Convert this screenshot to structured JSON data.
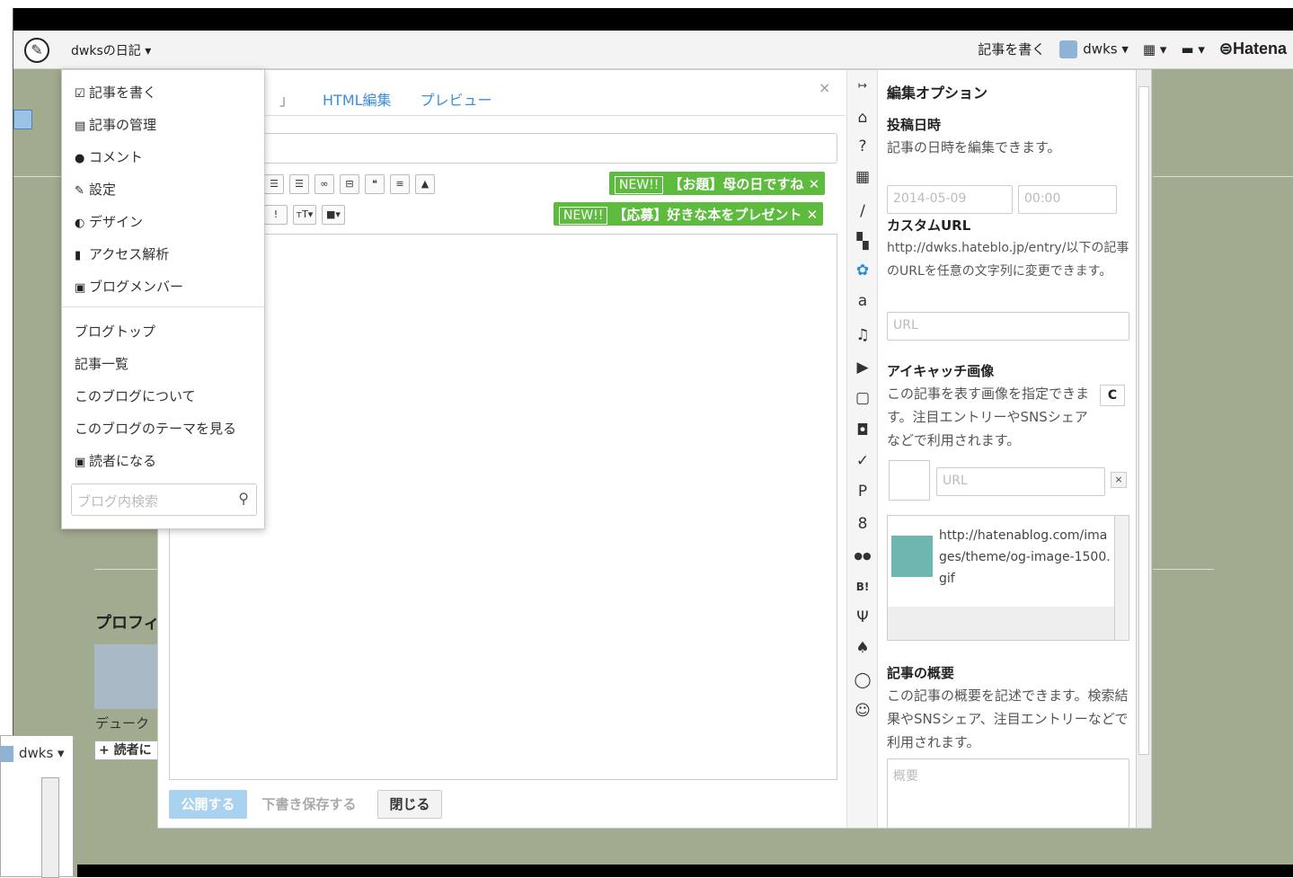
{
  "header": {
    "blog_name": "dwksの日記 ▾",
    "write_link": "記事を書く",
    "user": "dwks ▾",
    "apps_caret": "▾",
    "chat_caret": "▾",
    "brand": "Hatena"
  },
  "dropdown": {
    "items": [
      {
        "icon": "☑",
        "label": "記事を書く"
      },
      {
        "icon": "▤",
        "label": "記事の管理"
      },
      {
        "icon": "●",
        "label": "コメント"
      },
      {
        "icon": "✎",
        "label": "設定"
      },
      {
        "icon": "◐",
        "label": "デザイン"
      },
      {
        "icon": "▮",
        "label": "アクセス解析"
      },
      {
        "icon": "▣",
        "label": "ブログメンバー"
      }
    ],
    "links": [
      "ブログトップ",
      "記事一覧",
      "このブログについて",
      "このブログのテーマを見る"
    ],
    "subscribe_icon": "▣",
    "subscribe": "読者になる",
    "search_placeholder": "ブログ内検索",
    "search_icon": "search-icon"
  },
  "editor": {
    "tab_current": "」",
    "tab_html": "HTML編集",
    "tab_preview": "プレビュー",
    "close": "×",
    "toolbar1": [
      "☰",
      "☰",
      "∞",
      "⊟",
      "❝",
      "≡",
      "▲"
    ],
    "toolbar2": [
      "!",
      "тT▾",
      "■▾"
    ],
    "badge1_new": "NEW!!",
    "badge1_text": "【お題】母の日ですね ✕",
    "badge2_new": "NEW!!",
    "badge2_text": "【応募】好きな本をプレゼント ✕",
    "btn_publish": "公開する",
    "btn_draft": "下書き保存する",
    "btn_close": "閉じる"
  },
  "icon_column": [
    "↦",
    "⌂",
    "?",
    "▦",
    "∕",
    "▚",
    "✿",
    "a",
    "♫",
    "▶",
    "▢",
    "◘",
    "✓",
    "P",
    "8",
    "●●",
    "B!",
    "Ψ",
    "♠",
    "◯",
    "☺"
  ],
  "options": {
    "title": "編集オプション",
    "post_date_heading": "投稿日時",
    "post_date_desc": "記事の日時を編集できます。",
    "date_value": "2014-05-09",
    "time_value": "00:00",
    "custom_url_heading": "カスタムURL",
    "custom_url_desc": "http://dwks.hateblo.jp/entry/以下の記事のURLを任意の文字列に変更できます。",
    "url_placeholder": "URL",
    "eyecatch_heading": "アイキャッチ画像",
    "eyecatch_desc": "この記事を表す画像を指定できます。注目エントリーやSNSシェアなどで利用されます。",
    "refresh": "C",
    "image_url_placeholder": "URL",
    "remove": "×",
    "image_list_url": "http://hatenablog.com/images/theme/og-image-1500.gif",
    "summary_heading": "記事の概要",
    "summary_desc": "この記事の概要を記述できます。検索結果やSNSシェア、注目エントリーなどで利用されます。",
    "summary_placeholder": "概要"
  },
  "sidebar": {
    "profile_title": "プロフィ",
    "name": "デューク",
    "follow": "+ 読者に"
  },
  "popup": {
    "user": "dwks ▾"
  }
}
